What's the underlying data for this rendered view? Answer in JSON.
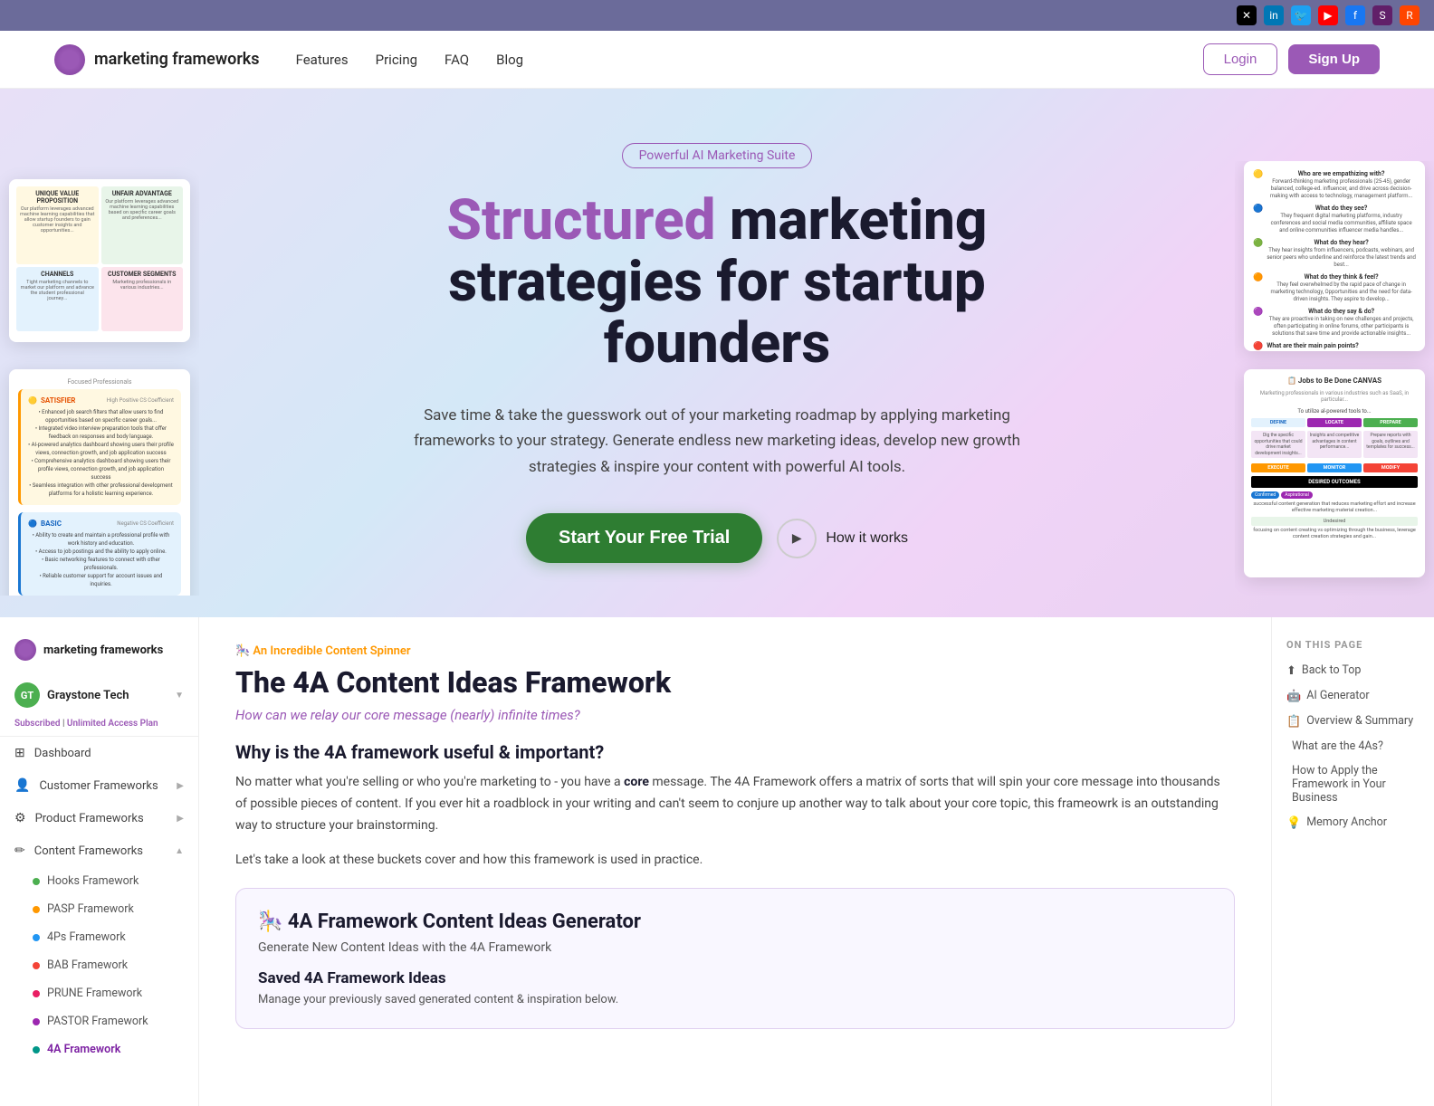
{
  "social_bar": {
    "icons": [
      "X",
      "in",
      "🐦",
      "▶",
      "f",
      "slack",
      "reddit"
    ]
  },
  "navbar": {
    "logo_text": "marketing frameworks",
    "links": [
      "Features",
      "Pricing",
      "FAQ",
      "Blog"
    ],
    "login_label": "Login",
    "signup_label": "Sign Up"
  },
  "hero": {
    "badge": "Powerful AI Marketing Suite",
    "title_part1": "Structured",
    "title_part2": "marketing strategies for startup founders",
    "subtitle": "Save time & take the guesswork out of your marketing roadmap by applying marketing frameworks to your strategy.  Generate endless new marketing ideas, develop new growth strategies & inspire your content with powerful AI tools.",
    "cta_button": "Start Your Free Trial",
    "how_label": "How it works"
  },
  "sidebar": {
    "logo_text": "marketing frameworks",
    "user_initials": "GT",
    "user_name": "Graystone Tech",
    "badge_text": "Subscribed",
    "badge_plan": "Unlimited Access Plan",
    "items": [
      {
        "label": "Dashboard",
        "icon": "⊞"
      },
      {
        "label": "Customer Frameworks",
        "icon": "👤",
        "has_arrow": true
      },
      {
        "label": "Product Frameworks",
        "icon": "⚙",
        "has_arrow": true
      },
      {
        "label": "Content Frameworks",
        "icon": "✏",
        "has_arrow": true
      }
    ],
    "sub_items": [
      {
        "label": "Hooks Framework",
        "dot_color": "green"
      },
      {
        "label": "PASP Framework",
        "dot_color": "orange"
      },
      {
        "label": "4Ps Framework",
        "dot_color": "blue"
      },
      {
        "label": "BAB Framework",
        "dot_color": "red"
      },
      {
        "label": "PRUNE Framework",
        "dot_color": "pink"
      },
      {
        "label": "PASTOR Framework",
        "dot_color": "purple"
      },
      {
        "label": "4A Framework",
        "dot_color": "teal",
        "active": true
      }
    ]
  },
  "main": {
    "label": "🎠 An Incredible Content Spinner",
    "title": "The 4A Content Ideas Framework",
    "question": "How can we relay our core message (nearly) infinite times?",
    "section1_title": "Why is the 4A framework useful & important?",
    "body1": "No matter what you're selling or who you're marketing to - you have a core message. The 4A Framework offers a matrix of sorts that will spin your core message into thousands of possible pieces of content. If you ever hit a roadblock in your writing and can't seem to conjure up another way to talk about your core topic, this frameowrk is an outstanding way to structure your brainstorming.",
    "note": "Let's take a look at these buckets cover and how this framework is used in practice.",
    "generator_emoji": "🎠",
    "generator_title": "4A Framework Content Ideas Generator",
    "generator_desc": "Generate New Content Ideas with the 4A Framework",
    "saved_title": "Saved 4A Framework Ideas",
    "saved_desc": "Manage your previously saved generated content & inspiration below."
  },
  "toc": {
    "header": "ON THIS PAGE",
    "items": [
      {
        "icon": "⬆",
        "label": "Back to Top"
      },
      {
        "icon": "🤖",
        "label": "AI Generator"
      },
      {
        "icon": "📋",
        "label": "Overview & Summary"
      },
      {
        "icon": "",
        "label": "What are the 4As?"
      },
      {
        "icon": "",
        "label": "How to Apply the Framework in Your Business"
      },
      {
        "icon": "💡",
        "label": "Memory Anchor"
      }
    ]
  }
}
